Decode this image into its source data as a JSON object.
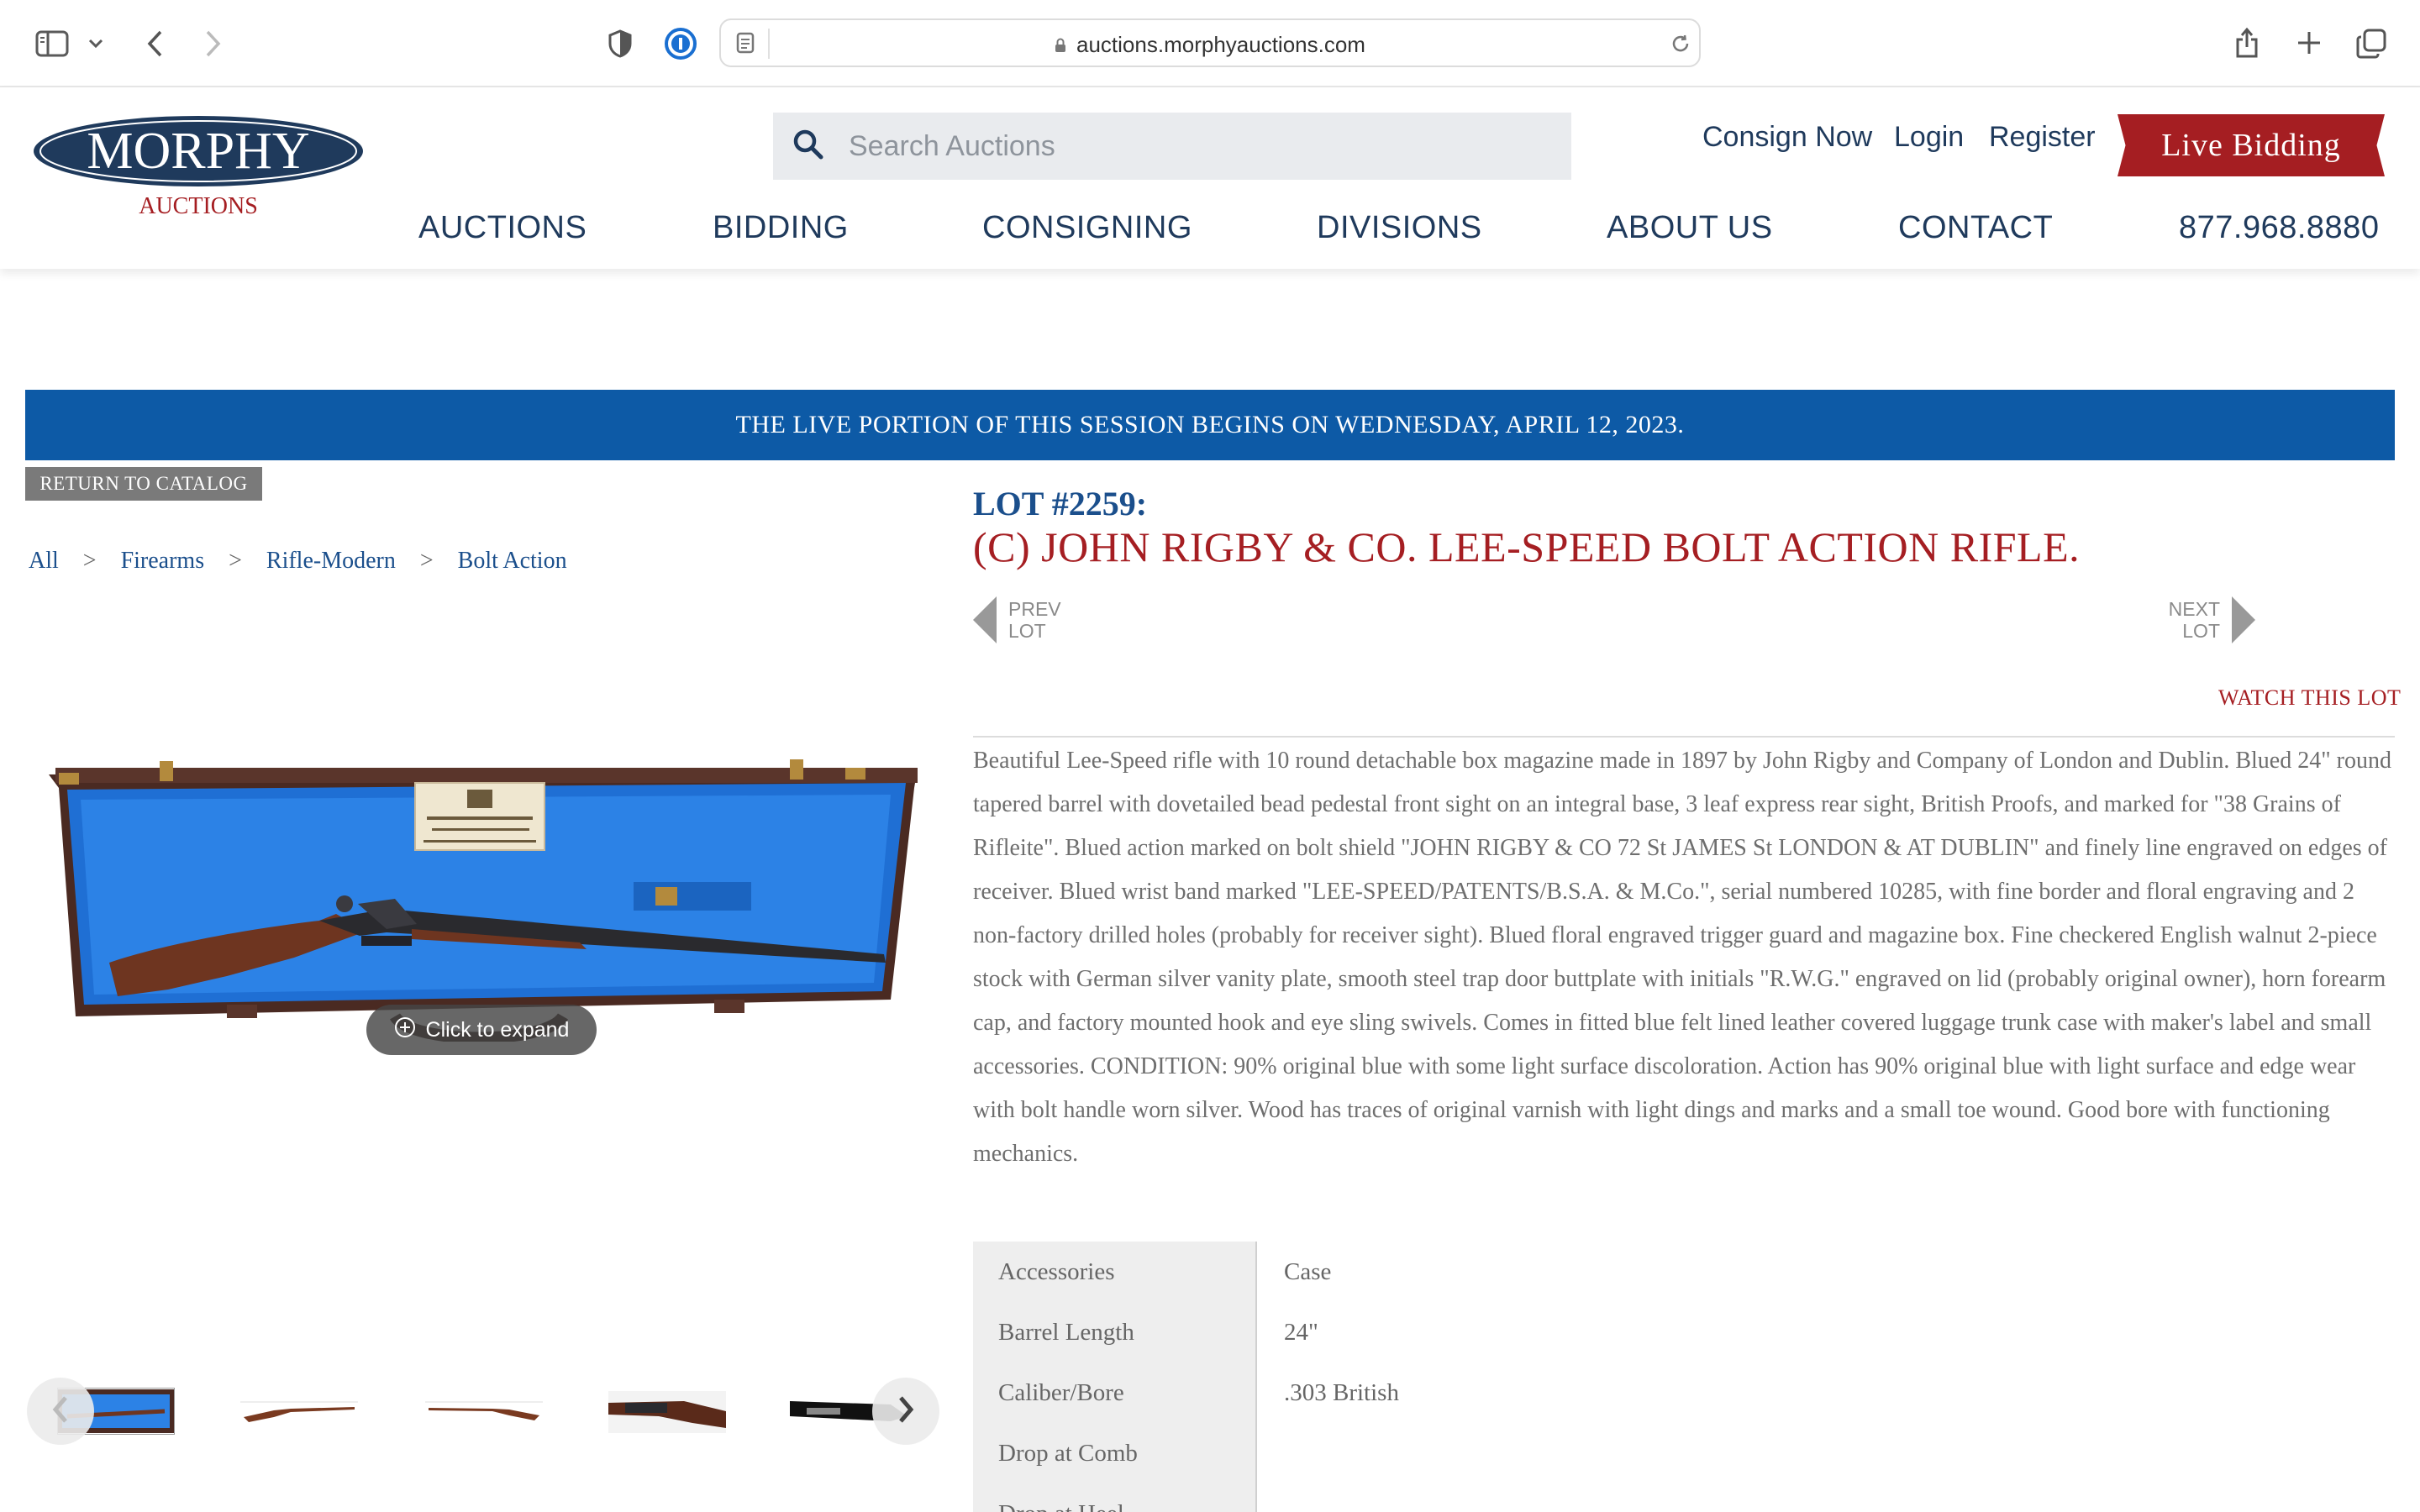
{
  "browser": {
    "url": "auctions.morphyauctions.com"
  },
  "header": {
    "logo": {
      "name": "MORPHY",
      "subtitle": "AUCTIONS"
    },
    "search": {
      "placeholder": "Search Auctions",
      "value": ""
    },
    "links": {
      "consign": "Consign Now",
      "login": "Login",
      "register": "Register"
    },
    "live_bidding": "Live Bidding",
    "nav": [
      "AUCTIONS",
      "BIDDING",
      "CONSIGNING",
      "DIVISIONS",
      "ABOUT US",
      "CONTACT"
    ],
    "phone": "877.968.8880"
  },
  "banner": "THE LIVE PORTION OF THIS SESSION BEGINS ON WEDNESDAY, APRIL 12, 2023.",
  "return_label": "RETURN TO CATALOG",
  "breadcrumb": [
    "All",
    "Firearms",
    "Rifle-Modern",
    "Bolt Action"
  ],
  "breadcrumb_sep": ">",
  "gallery": {
    "expand_label": "Click to expand",
    "thumbnail_count": 5
  },
  "lot": {
    "number": "LOT #2259:",
    "title": "(C) JOHN RIGBY & CO. LEE-SPEED BOLT ACTION RIFLE.",
    "prev": [
      "PREV",
      "LOT"
    ],
    "next": [
      "NEXT",
      "LOT"
    ],
    "watch": "WATCH THIS LOT",
    "description": "Beautiful Lee-Speed rifle with 10 round detachable box magazine made in 1897 by John Rigby and Company of London and Dublin. Blued 24\" round tapered barrel with dovetailed bead pedestal front sight on an integral base, 3 leaf express rear sight, British Proofs, and marked for \"38 Grains of Rifleite\". Blued action marked on bolt shield \"JOHN RIGBY & CO 72 St JAMES St LONDON & AT DUBLIN\" and finely line engraved on edges of receiver. Blued wrist band marked \"LEE-SPEED/PATENTS/B.S.A. & M.Co.\", serial numbered 10285, with fine border and floral engraving and 2 non-factory drilled holes (probably for receiver sight). Blued floral engraved trigger guard and magazine box. Fine checkered English walnut 2-piece stock with German silver vanity plate, smooth steel trap door buttplate with initials \"R.W.G.\" engraved on lid (probably original owner), horn forearm cap, and factory mounted hook and eye sling swivels. Comes in fitted blue felt lined leather covered luggage trunk case with maker's label and small accessories. CONDITION: 90% original blue with some light surface discoloration. Action has 90% original blue with light surface and edge wear with bolt handle worn silver. Wood has traces of original varnish with light dings and marks and a small toe wound. Good bore with functioning mechanics.",
    "specs": [
      {
        "label": "Accessories",
        "value": "Case"
      },
      {
        "label": "Barrel Length",
        "value": "24\""
      },
      {
        "label": "Caliber/Bore",
        "value": ".303 British"
      },
      {
        "label": "Drop at Comb",
        "value": ""
      },
      {
        "label": "Drop at Heel",
        "value": ""
      }
    ]
  },
  "colors": {
    "navy": "#1f3a5c",
    "brand_red": "#a51e22",
    "banner_blue": "#0d5aa6",
    "link_blue": "#1b4f8c"
  }
}
